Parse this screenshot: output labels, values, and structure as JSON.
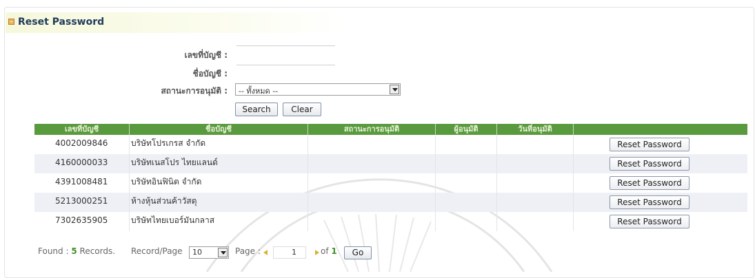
{
  "page": {
    "title": "Reset Password"
  },
  "filters": {
    "account_no_label": "เลขที่บัญชี :",
    "account_name_label": "ชื่อบัญชี :",
    "approval_status_label": "สถานะการอนุมัติ :",
    "approval_status_value": "-- ทั้งหมด --",
    "search_label": "Search",
    "clear_label": "Clear"
  },
  "table": {
    "headers": [
      "เลขที่บัญชี",
      "ชื่อบัญชี",
      "สถานะการอนุมัติ",
      "ผู้อนุมัติ",
      "วันที่อนุมัติ"
    ],
    "rows": [
      {
        "account_no": "4002009846",
        "account_name": "บริษัทโปรเกรส  จำกัด",
        "status": "",
        "approver": "",
        "approved_date": "",
        "action": "Reset Password"
      },
      {
        "account_no": "4160000033",
        "account_name": "บริษัทเนสโปร  ไทยแลนด์",
        "status": "",
        "approver": "",
        "approved_date": "",
        "action": "Reset Password"
      },
      {
        "account_no": "4391008481",
        "account_name": "บริษัทอินฟินิต  จำกัด",
        "status": "",
        "approver": "",
        "approved_date": "",
        "action": "Reset Password"
      },
      {
        "account_no": "5213000251",
        "account_name": "ห้างหุ้นส่วนค้าวัสดุ",
        "status": "",
        "approver": "",
        "approved_date": "",
        "action": "Reset Password"
      },
      {
        "account_no": "7302635905",
        "account_name": "บริษัทไทยเบอร์มันกลาส",
        "status": "",
        "approver": "",
        "approved_date": "",
        "action": "Reset Password"
      }
    ]
  },
  "pagination": {
    "found_prefix": "Found :",
    "found_count": "5",
    "found_suffix": "Records.",
    "record_page_label": "Record/Page",
    "record_page_value": "10",
    "page_label": "Page :",
    "page_value": "1",
    "of_label": "of",
    "total_pages": "1",
    "go_label": "Go"
  },
  "colors": {
    "header_green": "#5a9a3e",
    "found_count_green": "#3f8f2b",
    "title_navy": "#1f3a5b",
    "arrow_gold": "#d8b233"
  },
  "icons": [
    "section-icon",
    "dropdown-arrow-icon",
    "prev-page-icon",
    "next-page-icon"
  ]
}
